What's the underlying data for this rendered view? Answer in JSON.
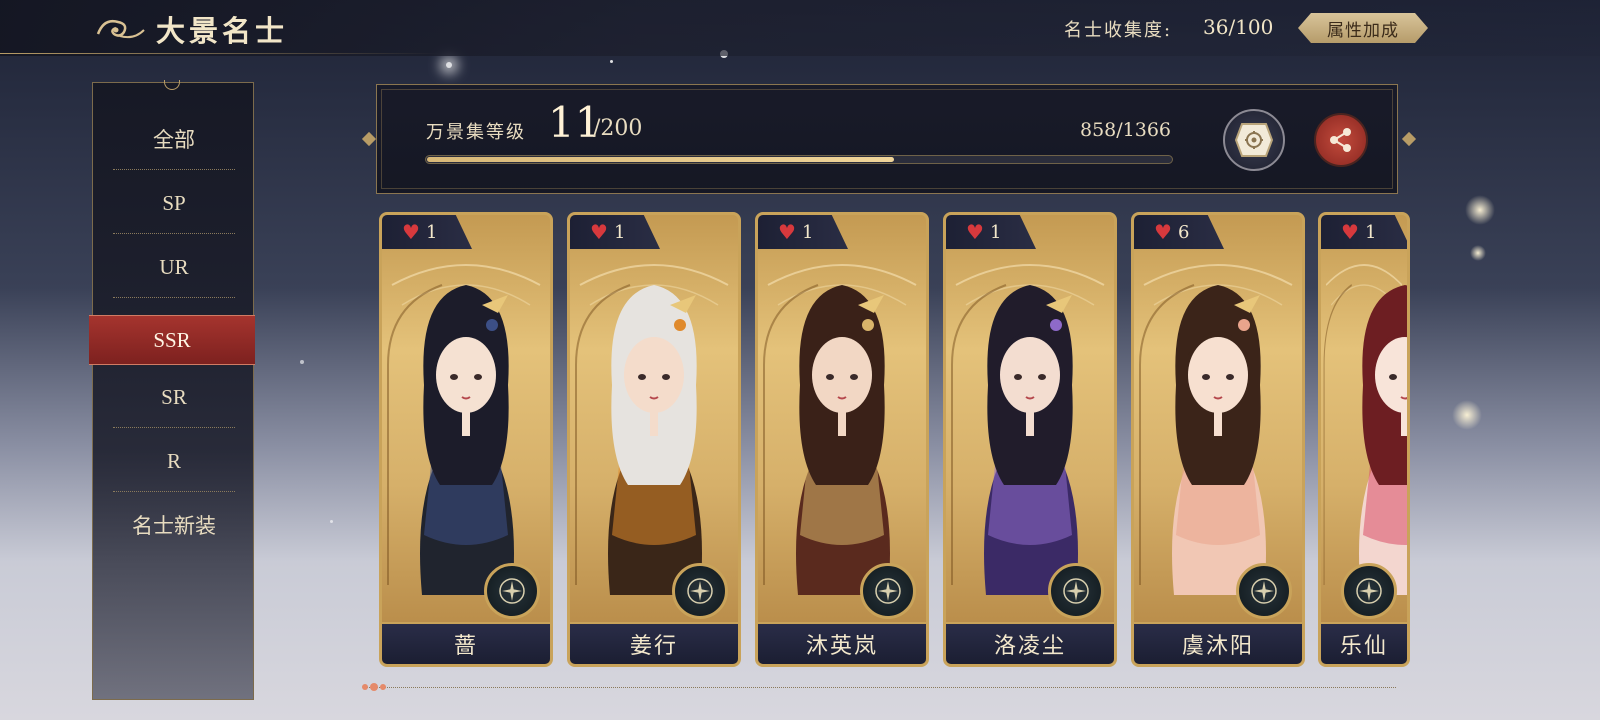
{
  "header": {
    "title": "大景名士",
    "collection_label": "名士收集度:",
    "collection_value": "36/100",
    "attribute_bonus_label": "属性加成"
  },
  "sidebar": {
    "items": [
      {
        "label": "全部",
        "active": false
      },
      {
        "label": "SP",
        "active": false
      },
      {
        "label": "UR",
        "active": false
      },
      {
        "label": "SSR",
        "active": true
      },
      {
        "label": "SR",
        "active": false
      },
      {
        "label": "R",
        "active": false
      },
      {
        "label": "名士新装",
        "active": false
      }
    ]
  },
  "level_panel": {
    "label": "万景集等级",
    "level": "11",
    "level_max": "/200",
    "exp_text": "858/1366",
    "exp_progress": 0.628
  },
  "cards": [
    {
      "name": "蔷",
      "hearts": "1",
      "palette": {
        "hair": "#1c1c2a",
        "robe": "#20242e",
        "skin": "#f5e1d2",
        "accent": "#3c4f86"
      }
    },
    {
      "name": "姜行",
      "hearts": "1",
      "palette": {
        "hair": "#e6e3df",
        "robe": "#3a2618",
        "skin": "#f4dccb",
        "accent": "#e08a2c"
      }
    },
    {
      "name": "沐英岚",
      "hearts": "1",
      "palette": {
        "hair": "#3a2118",
        "robe": "#5a2a1e",
        "skin": "#f2d7c4",
        "accent": "#d9b46a"
      }
    },
    {
      "name": "洛凌尘",
      "hearts": "1",
      "palette": {
        "hair": "#211c2b",
        "robe": "#3b2a66",
        "skin": "#f3ddd0",
        "accent": "#8e6ac9"
      }
    },
    {
      "name": "虞沐阳",
      "hearts": "6",
      "palette": {
        "hair": "#3b2419",
        "robe": "#f1c7b4",
        "skin": "#f7e0d0",
        "accent": "#e9a48c"
      }
    },
    {
      "name": "乐仙",
      "hearts": "1",
      "palette": {
        "hair": "#6d1e22",
        "robe": "#f3d6cf",
        "skin": "#f8e4d9",
        "accent": "#d9506a"
      }
    }
  ],
  "icons": {
    "title": "cloud-swirl-icon",
    "heart": "heart-icon",
    "emblem": "compass-emblem-icon",
    "book": "collection-book-icon",
    "share": "share-icon"
  }
}
